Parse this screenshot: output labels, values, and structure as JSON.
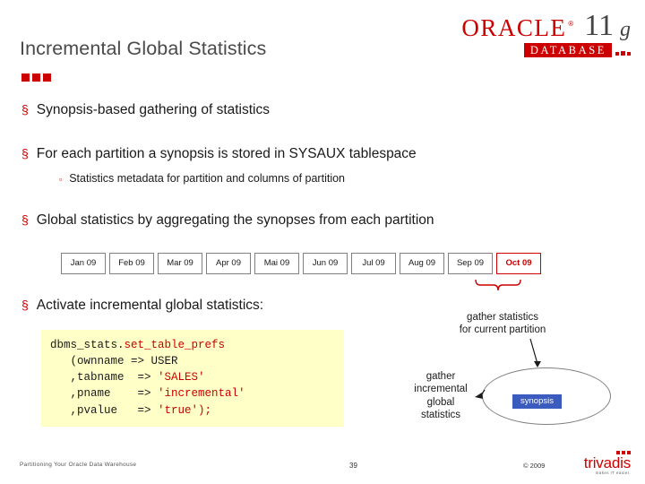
{
  "slide": {
    "title": "Incremental Global Statistics",
    "bullets": [
      {
        "text": "Synopsis-based gathering of statistics"
      },
      {
        "text": "For each partition a synopsis is stored in SYSAUX tablespace"
      },
      {
        "text": "Global statistics by aggregating the synopses from each partition"
      },
      {
        "text": "Activate incremental global statistics:"
      }
    ],
    "subbullets": [
      {
        "text": "Statistics metadata for partition and columns of partition"
      }
    ],
    "months": [
      {
        "label": "Jan 09",
        "highlight": false
      },
      {
        "label": "Feb 09",
        "highlight": false
      },
      {
        "label": "Mar 09",
        "highlight": false
      },
      {
        "label": "Apr 09",
        "highlight": false
      },
      {
        "label": "Mai 09",
        "highlight": false
      },
      {
        "label": "Jun 09",
        "highlight": false
      },
      {
        "label": "Jul 09",
        "highlight": false
      },
      {
        "label": "Aug 09",
        "highlight": false
      },
      {
        "label": "Sep 09",
        "highlight": false
      },
      {
        "label": "Oct 09",
        "highlight": true
      }
    ],
    "code": {
      "line1_a": "dbms_stats.",
      "line1_b": "set_table_prefs",
      "line2_a": "   (ownname ",
      "line2_b": "=> USER",
      "line3_a": "   ,tabname  => ",
      "line3_b": "'SALES'",
      "line4_a": "   ,pname    => ",
      "line4_b": "'incremental'",
      "line5_a": "   ,pvalue   => ",
      "line5_b": "'true');"
    },
    "diagram": {
      "gather_current": "gather statistics\nfor current partition",
      "gather_global": "gather\nincremental\nglobal\nstatistics",
      "synopsis": "synopsis"
    },
    "footer": {
      "left": "Partitioning Your Oracle Data Warehouse",
      "page": "39",
      "copyright": "© 2009"
    },
    "logo": {
      "oracle_word": "ORACLE",
      "oracle_tm": "®",
      "version_number": "11",
      "version_letter": "g",
      "database": "DATABASE"
    },
    "brand": {
      "name": "trivadis",
      "tagline": "makes IT easier."
    }
  }
}
